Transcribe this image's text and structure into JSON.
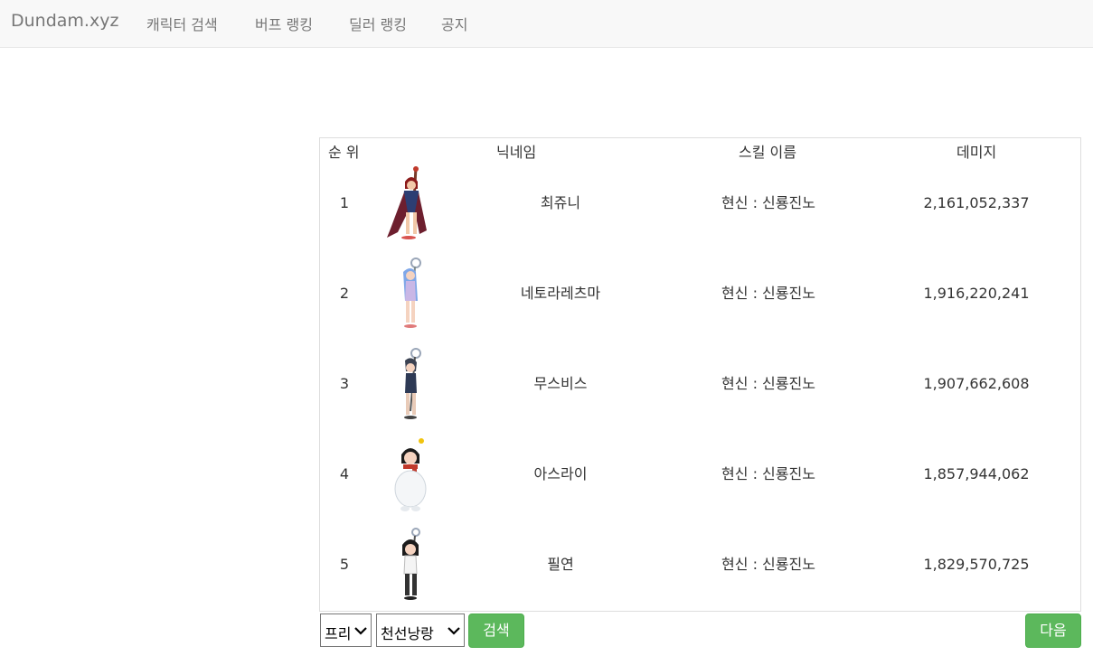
{
  "navbar": {
    "brand": "Dundam.xyz",
    "links": [
      "캐릭터 검색",
      "버프 랭킹",
      "딜러 랭킹",
      "공지"
    ]
  },
  "table": {
    "headers": {
      "rank": "순 위",
      "nickname": "닉네임",
      "skill": "스킬 이름",
      "damage": "데미지"
    },
    "rows": [
      {
        "rank": "1",
        "nickname": "최쥬니",
        "skill": "현신 : 신룡진노",
        "damage": "2,161,052,337",
        "avatar": "red-robed-fighter-avatar"
      },
      {
        "rank": "2",
        "nickname": "네토라레츠마",
        "skill": "현신 : 신룡진노",
        "damage": "1,916,220,241",
        "avatar": "blue-haired-fighter-avatar"
      },
      {
        "rank": "3",
        "nickname": "무스비스",
        "skill": "현신 : 신룡진노",
        "damage": "1,907,662,608",
        "avatar": "dark-outfit-fighter-avatar"
      },
      {
        "rank": "4",
        "nickname": "아스라이",
        "skill": "현신 : 신룡진노",
        "damage": "1,857,944,062",
        "avatar": "snowman-costume-avatar"
      },
      {
        "rank": "5",
        "nickname": "필연",
        "skill": "현신 : 신룡진노",
        "damage": "1,829,570,725",
        "avatar": "black-haired-fighter-avatar"
      }
    ]
  },
  "controls": {
    "server_select": "프리",
    "class_select": "천선낭랑",
    "search_button": "검색",
    "next_button": "다음"
  },
  "colors": {
    "navbar_bg": "#f8f8f8",
    "nav_text": "#777777",
    "button_green": "#5cb85c",
    "border": "#dddddd"
  }
}
